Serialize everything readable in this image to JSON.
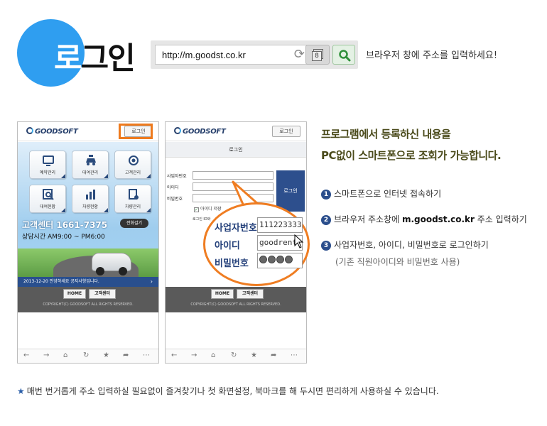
{
  "header": {
    "title_first": "로",
    "title_rest": "그인",
    "url": "http://m.goodst.co.kr",
    "tab_count": "8",
    "hint": "브라우저 창에 주소를 입력하세요!"
  },
  "phone_common": {
    "logo": "GOODSOFT",
    "login_chip": "로그인",
    "footer_home": "HOME",
    "footer_center": "고객센터",
    "copyright": "COPYRIGHT(C) GOODSOFT ALL RIGHTS RESERVED."
  },
  "phone1": {
    "menus": [
      "예약관리",
      "대여관리",
      "고객관리",
      "대여현황",
      "차량현황",
      "차량관리"
    ],
    "call_center": "고객센터 1661-7375",
    "call_button": "전화걸기",
    "hours": "상담시간 AM9:00 ~ PM6:00",
    "notice": "2013-12-20 안녕하세요 공지사항입니다."
  },
  "phone2": {
    "header": "로그인",
    "labels": {
      "biz": "사업자번호",
      "id": "아이디",
      "pw": "비밀번호"
    },
    "login_button": "로그인",
    "save_id": "아이디 저장",
    "id_hint": "로그인 ID와",
    "zoom_values": {
      "biz": "111223333",
      "id": "goodrent"
    }
  },
  "intro": {
    "line1": "프로그램에서 등록하신 내용을",
    "line2": "PC없이 스마트폰으로 조회가 가능합니다."
  },
  "steps": [
    {
      "num": "1",
      "text": "스마트폰으로 인터넷 접속하기"
    },
    {
      "num": "2",
      "pre": "브라우저 주소창에 ",
      "bold": "m.goodst.co.kr",
      "post": " 주소 입력하기"
    },
    {
      "num": "3",
      "text": "사업자번호, 아이디, 비밀번호로 로그인하기"
    }
  ],
  "step_note": "(기존 직원아이디와 비밀번호 사용)",
  "bottom_note": "매번 번거롭게 주소 입력하실 필요없이 즐겨찾기나 첫 화면설정, 북마크를 해 두시면 편리하게 사용하실 수 있습니다.",
  "colors": {
    "accent_blue": "#2f9ef0",
    "navy": "#2b4e8c",
    "highlight_orange": "#ee7a1d"
  }
}
